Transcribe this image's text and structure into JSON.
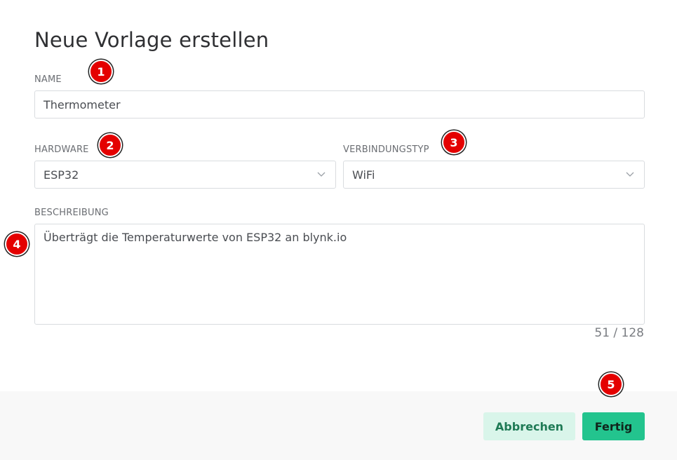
{
  "dialog": {
    "title": "Neue Vorlage erstellen"
  },
  "form": {
    "name": {
      "label": "NAME",
      "value": "Thermometer"
    },
    "hardware": {
      "label": "HARDWARE",
      "value": "ESP32"
    },
    "connection": {
      "label": "VERBINDUNGSTYP",
      "value": "WiFi"
    },
    "description": {
      "label": "BESCHREIBUNG",
      "value": "Überträgt die Temperaturwerte von ESP32 an blynk.io",
      "counter": "51 / 128"
    }
  },
  "footer": {
    "cancel_label": "Abbrechen",
    "done_label": "Fertig"
  },
  "markers": [
    "1",
    "2",
    "3",
    "4",
    "5"
  ],
  "colors": {
    "primary": "#23c48e",
    "secondary": "#d9f5ea",
    "marker": "#e40000"
  }
}
